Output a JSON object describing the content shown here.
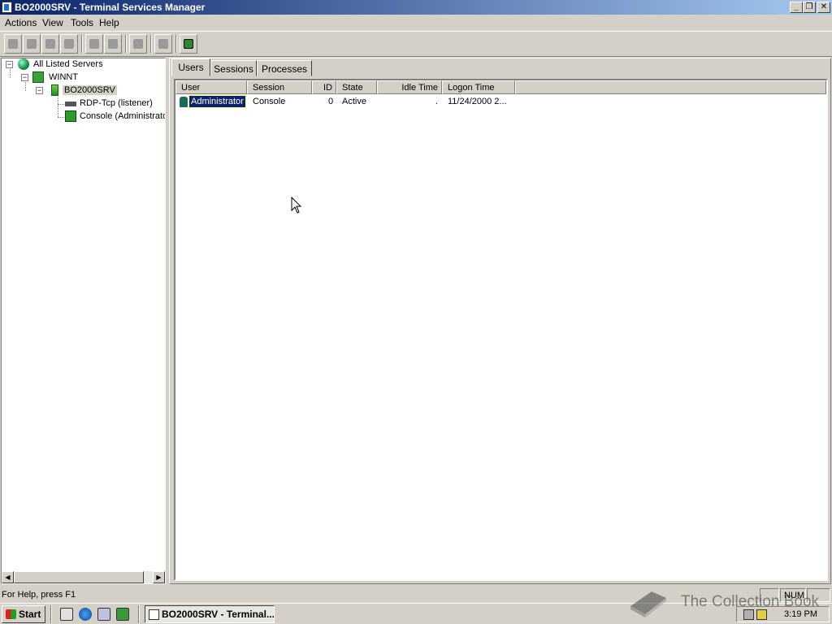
{
  "window": {
    "title": "BO2000SRV - Terminal Services Manager",
    "controls": {
      "minimize": "_",
      "restore": "❐",
      "close": "✕"
    }
  },
  "menu": [
    "Actions",
    "View",
    "Tools",
    "Help"
  ],
  "toolbar": {
    "icons": [
      "connect-icon",
      "disconnect-icon",
      "send-message-icon",
      "remote-control-icon",
      "reset-icon",
      "status-icon",
      "logoff-icon",
      "end-process-icon",
      "refresh-icon"
    ]
  },
  "tree": {
    "root": "All Listed Servers",
    "domain": "WINNT",
    "server": "BO2000SRV",
    "children": [
      "RDP-Tcp (listener)",
      "Console (Administrato"
    ]
  },
  "tabs": [
    "Users",
    "Sessions",
    "Processes"
  ],
  "users_table": {
    "columns": [
      "User",
      "Session",
      "ID",
      "State",
      "Idle Time",
      "Logon Time"
    ],
    "rows": [
      {
        "user": "Administrator",
        "session": "Console",
        "id": "0",
        "state": "Active",
        "idle": ".",
        "logon": "11/24/2000 2..."
      }
    ]
  },
  "status": {
    "help": "For Help, press F1",
    "num": "NUM"
  },
  "taskbar": {
    "start": "Start",
    "task": "BO2000SRV - Terminal...",
    "clock": "3:19 PM"
  },
  "watermark": "The Collection Book"
}
